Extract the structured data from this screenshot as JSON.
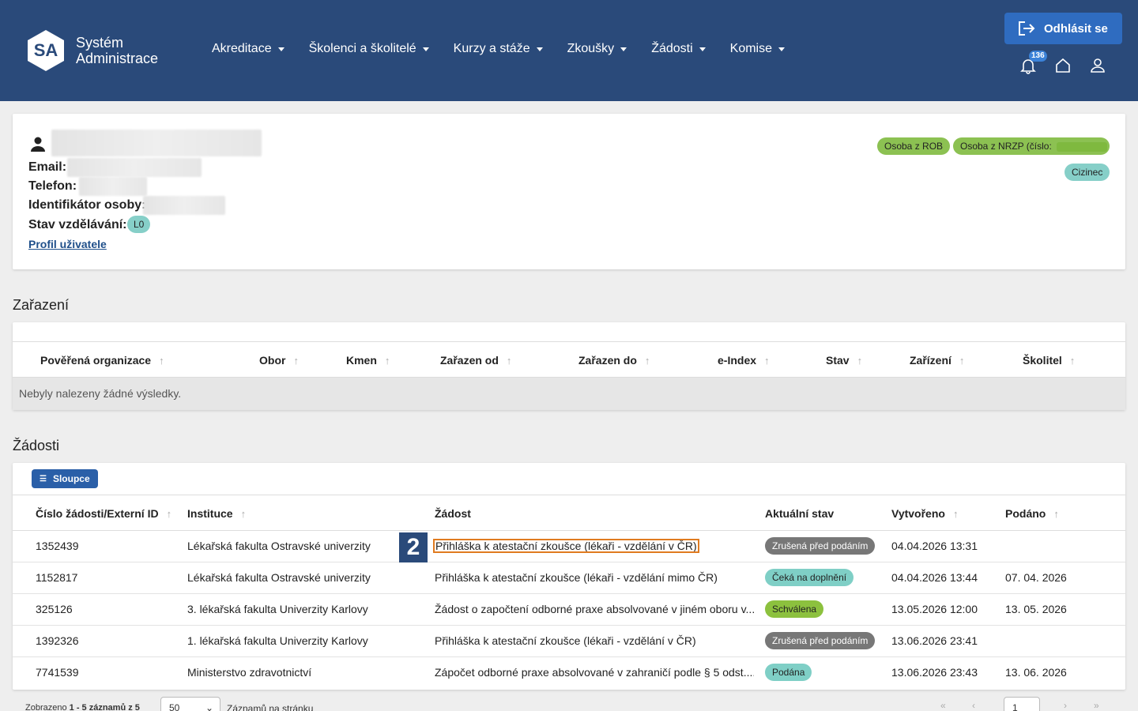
{
  "header": {
    "logo_text": "SA",
    "brand_line1": "Systém",
    "brand_line2": "Administrace",
    "nav": [
      "Akreditace",
      "Školenci a školitelé",
      "Kurzy a stáže",
      "Zkoušky",
      "Žádosti",
      "Komise"
    ],
    "logout_label": "Odhlásit se",
    "notification_count": "136"
  },
  "person": {
    "email_label": "Email:",
    "phone_label": "Telefon:",
    "id_label": "Identifikátor osoby:",
    "edu_label": "Stav vzdělávání:",
    "edu_value": "L0",
    "profile_link": "Profil uživatele",
    "badges": [
      "Osoba z ROB",
      "Osoba z NRZP (číslo:",
      "Cizinec"
    ]
  },
  "zarazeni": {
    "title": "Zařazení",
    "columns": [
      "Pověřená organizace",
      "Obor",
      "Kmen",
      "Zařazen od",
      "Zařazen do",
      "e-Index",
      "Stav",
      "Zařízení",
      "Školitel"
    ],
    "empty_text": "Nebyly nalezeny žádné výsledky."
  },
  "zadosti": {
    "title": "Žádosti",
    "columns_button": "Sloupce",
    "columns": [
      "Číslo žádosti/Externí ID",
      "Instituce",
      "Žádost",
      "Aktuální stav",
      "Vytvořeno",
      "Podáno"
    ],
    "rows": [
      {
        "id": "1352439",
        "inst": "Lékařská fakulta Ostravské univerzity",
        "req": "Přihláška k atestační zkoušce (lékaři - vzdělání v ČR)",
        "state": "Zrušená před podáním",
        "created": "04.04.2026 13:31",
        "submitted": ""
      },
      {
        "id": "1152817",
        "inst": "Lékařská fakulta Ostravské univerzity",
        "req": "Přihláška k atestační zkoušce (lékaři - vzdělání mimo ČR)",
        "state": "Čeká na doplnění",
        "created": "04.04.2026 13:44",
        "submitted": "07. 04. 2026"
      },
      {
        "id": "325126",
        "inst": "3. lékařská fakulta Univerzity Karlovy",
        "req": "Žádost o započtení odborné praxe absolvované v jiném oboru v...",
        "state": "Schválena",
        "created": "13.05.2026 12:00",
        "submitted": "13. 05. 2026"
      },
      {
        "id": "1392326",
        "inst": "1. lékařská fakulta Univerzity Karlovy",
        "req": "Přihláška k atestační zkoušce (lékaři - vzdělání v ČR)",
        "state": "Zrušená před podáním",
        "created": "13.06.2026 23:41",
        "submitted": ""
      },
      {
        "id": "7741539",
        "inst": "Ministerstvo zdravotnictví",
        "req": "Zápočet odborné praxe absolvované v zahraničí podle § 5 odst....",
        "state": "Podána",
        "created": "13.06.2026 23:43",
        "submitted": "13. 06. 2026"
      }
    ],
    "marker": "2"
  },
  "pager": {
    "summary_prefix": "Zobrazeno",
    "summary_range": "1 - 5 záznamů z 5",
    "page_size": "50",
    "page_size_label": "Záznamů na stránku",
    "page": "1"
  },
  "colors": {
    "header_bg": "#2a4a7a",
    "logout_bg": "#2f6cc0",
    "highlight": "#e07b20"
  }
}
